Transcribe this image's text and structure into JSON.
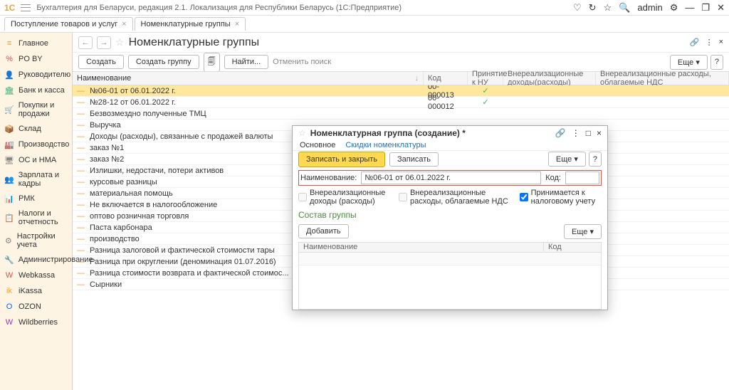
{
  "app": {
    "logo": "1C",
    "title": "Бухгалтерия для Беларуси, редакция 2.1. Локализация для Республики Беларусь  (1С:Предприятие)",
    "user": "admin"
  },
  "tabs": [
    {
      "label": "Поступление товаров и услуг"
    },
    {
      "label": "Номенклатурные группы"
    }
  ],
  "sidebar": [
    {
      "icon": "≡",
      "label": "Главное",
      "c": "#e8a33d"
    },
    {
      "icon": "%",
      "label": "PO BY",
      "c": "#d9534f"
    },
    {
      "icon": "👤",
      "label": "Руководителю",
      "c": "#e8a33d"
    },
    {
      "icon": "🏛",
      "label": "Банк и касса",
      "c": "#3a7"
    },
    {
      "icon": "🛒",
      "label": "Покупки и продажи",
      "c": "#3a7"
    },
    {
      "icon": "📦",
      "label": "Склад",
      "c": "#e8a33d"
    },
    {
      "icon": "🏭",
      "label": "Производство",
      "c": "#888"
    },
    {
      "icon": "🖥",
      "label": "ОС и НМА",
      "c": "#888"
    },
    {
      "icon": "👥",
      "label": "Зарплата и кадры",
      "c": "#5a9"
    },
    {
      "icon": "📊",
      "label": "РМК",
      "c": "#d9534f"
    },
    {
      "icon": "📋",
      "label": "Налоги и отчетность",
      "c": "#888"
    },
    {
      "icon": "⚙",
      "label": "Настройки учета",
      "c": "#888"
    },
    {
      "icon": "🔧",
      "label": "Администрирование",
      "c": "#888"
    },
    {
      "icon": "W",
      "label": "Webkassa",
      "c": "#d9534f"
    },
    {
      "icon": "ik",
      "label": "iKassa",
      "c": "#e8a33d"
    },
    {
      "icon": "O",
      "label": "OZON",
      "c": "#06f"
    },
    {
      "icon": "W",
      "label": "Wildberries",
      "c": "#93b"
    }
  ],
  "page": {
    "title": "Номенклатурные группы",
    "create": "Создать",
    "createGroup": "Создать группу",
    "find": "Найти...",
    "cancelFind": "Отменить поиск",
    "more": "Еще ▾",
    "help": "?"
  },
  "columns": {
    "name": "Наименование",
    "code": "Код",
    "nu": "Принятие к НУ",
    "vd": "Внереализационные доходы(расходы)",
    "vn": "Внереализационные расходы, облагаемые НДС"
  },
  "rows": [
    {
      "name": "№06-01 от 06.01.2022 г.",
      "code": "00-000013",
      "nu": "✓",
      "sel": true
    },
    {
      "name": "№28-12 от 06.01.2022 г.",
      "code": "00-000012",
      "nu": "✓"
    },
    {
      "name": "Безвозмездно полученные ТМЦ",
      "code": "",
      "nu": ""
    },
    {
      "name": "Выручка"
    },
    {
      "name": "Доходы (расходы), связанные с продажей валюты"
    },
    {
      "name": "заказ №1"
    },
    {
      "name": "заказ №2"
    },
    {
      "name": "Излишки, недостачи, потери активов"
    },
    {
      "name": "курсовые разницы"
    },
    {
      "name": "материальная помощь"
    },
    {
      "name": "Не включается в налогообложение"
    },
    {
      "name": "оптово розничная торговля"
    },
    {
      "name": "Паста карбонара"
    },
    {
      "name": "производство"
    },
    {
      "name": "Разница залоговой и фактической стоимости тары"
    },
    {
      "name": "Разница при округлении (деноминация 01.07.2016)"
    },
    {
      "name": "Разница стоимости возврата и фактической стоимос..."
    },
    {
      "name": "Сырники"
    }
  ],
  "dialog": {
    "title": "Номенклатурная группа (создание) *",
    "tabMain": "Основное",
    "tabDisc": "Скидки номенклатуры",
    "saveClose": "Записать и закрыть",
    "save": "Записать",
    "more": "Еще ▾",
    "help": "?",
    "lblName": "Наименование:",
    "valName": "№06-01 от 06.01.2022 г.",
    "lblCode": "Код:",
    "valCode": "",
    "chk1": "Внереализационные доходы (расходы)",
    "chk2": "Внереализационные расходы, облагаемые НДС",
    "chk3": "Принимается к налоговому учету",
    "section": "Состав группы",
    "add": "Добавить",
    "colName": "Наименование",
    "colCode": "Код"
  }
}
